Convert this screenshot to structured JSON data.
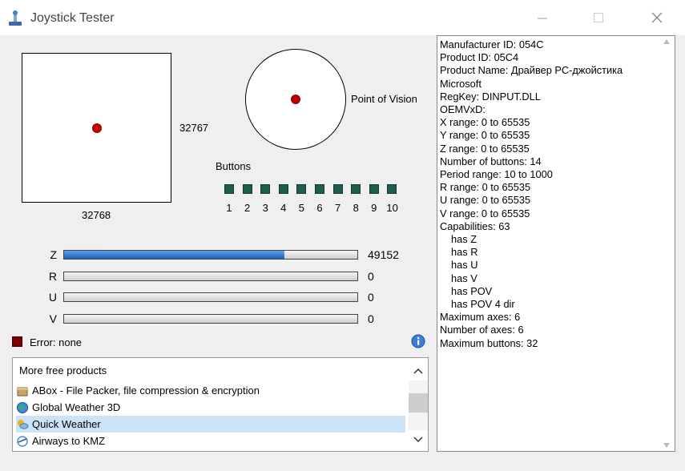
{
  "window": {
    "title": "Joystick Tester"
  },
  "xy": {
    "x_value": "32768",
    "y_value": "32767"
  },
  "pov": {
    "label": "Point of Vision"
  },
  "buttons": {
    "label": "Buttons",
    "numbers": [
      "1",
      "2",
      "3",
      "4",
      "5",
      "6",
      "7",
      "8",
      "9",
      "10"
    ]
  },
  "axes": [
    {
      "name": "Z",
      "value": "49152",
      "fraction": 0.75
    },
    {
      "name": "R",
      "value": "0",
      "fraction": 0
    },
    {
      "name": "U",
      "value": "0",
      "fraction": 0
    },
    {
      "name": "V",
      "value": "0",
      "fraction": 0
    }
  ],
  "status": {
    "error_text": "Error: none"
  },
  "products": {
    "header": "More free products",
    "items": [
      {
        "label": "ABox - File Packer, file compression & encryption",
        "icon": "package-icon",
        "selected": false
      },
      {
        "label": "Global Weather 3D",
        "icon": "globe-icon",
        "selected": false
      },
      {
        "label": "Quick Weather",
        "icon": "weather-icon",
        "selected": true
      },
      {
        "label": "Airways to KMZ",
        "icon": "airways-icon",
        "selected": false
      }
    ]
  },
  "info": {
    "lines": [
      {
        "text": "Manufacturer ID: 054C",
        "indent": false
      },
      {
        "text": "Product ID: 05C4",
        "indent": false
      },
      {
        "text": "Product Name: Драйвер PC-джойстика",
        "indent": false
      },
      {
        "text": "Microsoft",
        "indent": false
      },
      {
        "text": "RegKey: DINPUT.DLL",
        "indent": false
      },
      {
        "text": "OEMVxD:",
        "indent": false
      },
      {
        "text": "X range: 0 to 65535",
        "indent": false
      },
      {
        "text": "Y range: 0 to 65535",
        "indent": false
      },
      {
        "text": "Z range: 0 to 65535",
        "indent": false
      },
      {
        "text": "Number of buttons: 14",
        "indent": false
      },
      {
        "text": "Period range: 10 to 1000",
        "indent": false
      },
      {
        "text": "R range: 0 to 65535",
        "indent": false
      },
      {
        "text": "U range: 0 to 65535",
        "indent": false
      },
      {
        "text": "V range: 0 to 65535",
        "indent": false
      },
      {
        "text": "Capabilities: 63",
        "indent": false
      },
      {
        "text": "has Z",
        "indent": true
      },
      {
        "text": "has R",
        "indent": true
      },
      {
        "text": "has U",
        "indent": true
      },
      {
        "text": "has V",
        "indent": true
      },
      {
        "text": "has POV",
        "indent": true
      },
      {
        "text": "has POV 4 dir",
        "indent": true
      },
      {
        "text": "Maximum axes: 6",
        "indent": false
      },
      {
        "text": "Number of axes: 6",
        "indent": false
      },
      {
        "text": "Maximum buttons: 32",
        "indent": false
      }
    ]
  },
  "colors": {
    "accent": "#1a62c2",
    "dot": "#c00000",
    "button_led": "#1f5d4f",
    "selection": "#cde3f7"
  }
}
